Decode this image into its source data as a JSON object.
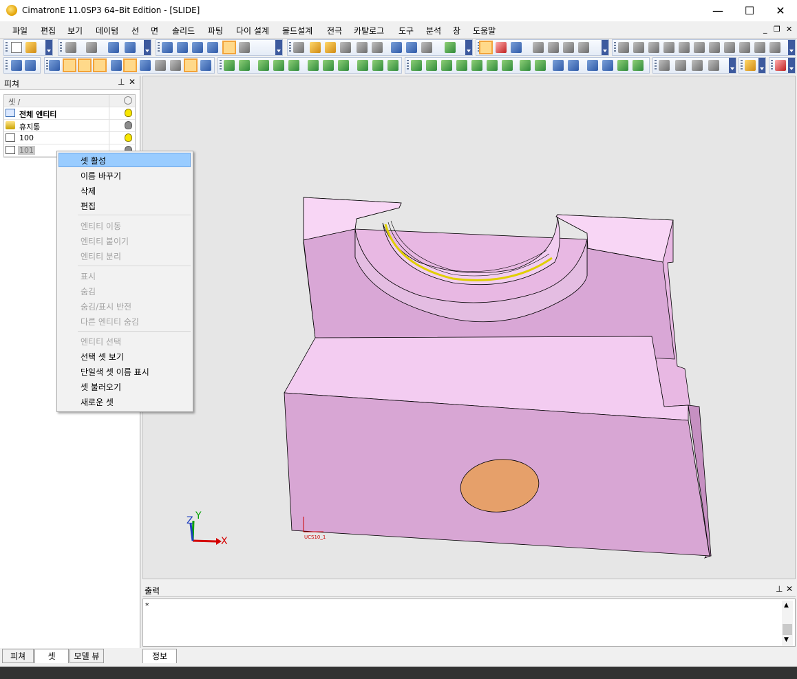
{
  "window": {
    "title": "CimatronE 11.0SP3 64–Bit Edition - [SLIDE]",
    "minimize": "—",
    "maximize": "☐",
    "close": "✕"
  },
  "menu": {
    "items": [
      "파일",
      "편집",
      "보기",
      "데이텀",
      "선",
      "면",
      "솔리드",
      "파팅",
      "다이 설계",
      "몰드설계",
      "전극",
      "카탈로그",
      "도구",
      "분석",
      "창",
      "도움말"
    ],
    "mdi_min": "_",
    "mdi_restore": "❐",
    "mdi_close": "✕"
  },
  "left_panel": {
    "title": "피쳐",
    "pin": "⊥",
    "close": "✕",
    "column_header": "셋 /",
    "rows": [
      {
        "name": "전체 엔티티",
        "bold": true,
        "bulb": "on"
      },
      {
        "name": "휴지통",
        "bold": false,
        "bulb": "off"
      },
      {
        "name": "100",
        "bold": false,
        "bulb": "on"
      },
      {
        "name": "101",
        "bold": false,
        "bulb": "off"
      }
    ],
    "tabs": [
      "피쳐",
      "셋",
      "모델 뷰"
    ]
  },
  "context_menu": {
    "items": [
      {
        "label": "셋 활성",
        "enabled": true,
        "highlighted": true
      },
      {
        "label": "이름 바꾸기",
        "enabled": true
      },
      {
        "label": "삭제",
        "enabled": true
      },
      {
        "label": "편집",
        "enabled": true
      },
      {
        "label": "엔티티 이동",
        "enabled": false
      },
      {
        "label": "엔티티 붙이기",
        "enabled": false
      },
      {
        "label": "엔티티 분리",
        "enabled": false
      },
      {
        "label": "표시",
        "enabled": false
      },
      {
        "label": "숨김",
        "enabled": false
      },
      {
        "label": "숨김/표시 반전",
        "enabled": false
      },
      {
        "label": "다른 엔티티 숨김",
        "enabled": false
      },
      {
        "label": "엔티티 선택",
        "enabled": false
      },
      {
        "label": "선택 셋 보기",
        "enabled": true
      },
      {
        "label": "단일색 셋 이름 표시",
        "enabled": true
      },
      {
        "label": "셋 불러오기",
        "enabled": true
      },
      {
        "label": "새로운 셋",
        "enabled": true
      }
    ]
  },
  "viewport": {
    "axis_labels": {
      "x": "X",
      "y": "Y",
      "z": "Z"
    },
    "ucs_label": "UCS10_1",
    "model_color": "#dba9d6",
    "hole_color": "#e6a06a"
  },
  "output": {
    "title": "출력",
    "pin": "⊥",
    "close": "✕",
    "text": "*",
    "tab": "정보"
  }
}
